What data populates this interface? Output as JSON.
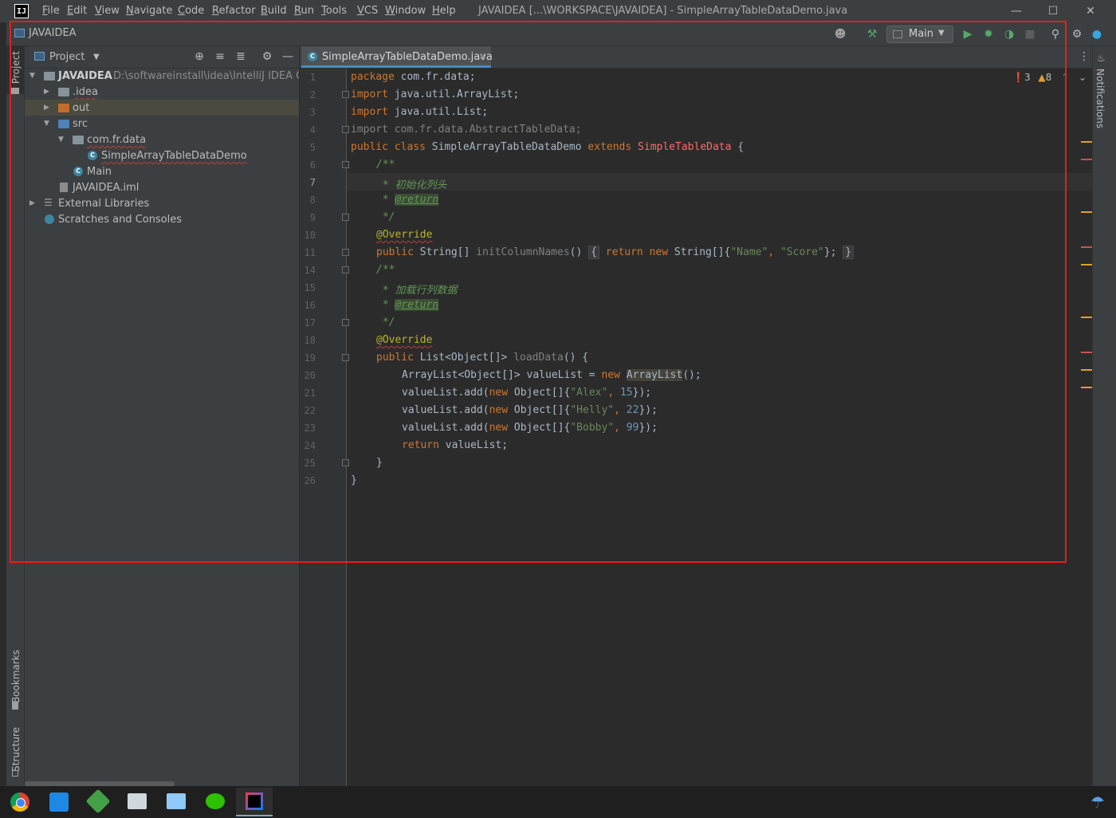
{
  "menu": [
    "File",
    "Edit",
    "View",
    "Navigate",
    "Code",
    "Refactor",
    "Build",
    "Run",
    "Tools",
    "VCS",
    "Window",
    "Help"
  ],
  "window_title": "JAVAIDEA [...\\WORKSPACE\\JAVAIDEA] - SimpleArrayTableDataDemo.java",
  "navbar": {
    "project_name": "JAVAIDEA",
    "run_config": "Main"
  },
  "stripe": {
    "project": "Project",
    "bookmarks": "Bookmarks",
    "structure": "Structure",
    "notifications": "Notifications"
  },
  "project_panel": {
    "title": "Project",
    "tree": [
      {
        "label": "JAVAIDEA",
        "path": "D:\\softwareinstall\\idea\\IntelliJ IDEA Com"
      },
      {
        "label": ".idea"
      },
      {
        "label": "out"
      },
      {
        "label": "src"
      },
      {
        "label": "com.fr.data"
      },
      {
        "label": "SimpleArrayTableDataDemo"
      },
      {
        "label": "Main"
      },
      {
        "label": "JAVAIDEA.iml"
      },
      {
        "label": "External Libraries"
      },
      {
        "label": "Scratches and Consoles"
      }
    ]
  },
  "editor": {
    "tab": "SimpleArrayTableDataDemo.java",
    "inspection": {
      "errors": "3",
      "warnings": "8"
    },
    "line_numbers": [
      "1",
      "2",
      "3",
      "4",
      "5",
      "6",
      "7",
      "8",
      "9",
      "10",
      "11",
      "14",
      "15",
      "16",
      "17",
      "18",
      "19",
      "20",
      "21",
      "22",
      "23",
      "24",
      "25",
      "26"
    ],
    "code": {
      "l1_kw": "package",
      "l1_rest": " com.fr.data;",
      "l2_kw": "import",
      "l2_rest": " java.util.ArrayList;",
      "l3_kw": "import",
      "l3_rest": " java.util.List;",
      "l4": "import com.fr.data.AbstractTableData;",
      "l5_kw": "public class ",
      "l5_name": "SimpleArrayTableDataDemo",
      "l5_ext": " extends ",
      "l5_super": "SimpleTableData",
      "l5_end": " {",
      "l6": "/**",
      "l7": " * 初始化列头",
      "l8_pre": " * ",
      "l8_tag": "@return",
      "l9": " */",
      "l10": "@Override",
      "l11_kw": "public ",
      "l11_type": "String[] ",
      "l11_fn": "initColumnNames",
      "l11_paren": "() ",
      "l11_open": "{",
      "l11_ret": " return new ",
      "l11_arr": "String[]{",
      "l11_s1": "\"Name\"",
      "l11_sep": ", ",
      "l11_s2": "\"Score\"",
      "l11_end": "};",
      "l11_close": "}",
      "l14": "/**",
      "l15": " * 加载行列数据",
      "l16_pre": " * ",
      "l16_tag": "@return",
      "l17": " */",
      "l18": "@Override",
      "l19_kw": "public ",
      "l19_type": "List<Object[]> ",
      "l19_fn": "loadData",
      "l19_end": "() {",
      "l20_a": "ArrayList<Object[]> valueList = ",
      "l20_new": "new ",
      "l20_cls": "ArrayList",
      "l20_end": "();",
      "l21_a": "valueList.add(",
      "l21_new": "new ",
      "l21_b": "Object[]{",
      "l21_s": "\"Alex\"",
      "l21_sep": ", ",
      "l21_n": "15",
      "l21_end": "});",
      "l22_a": "valueList.add(",
      "l22_new": "new ",
      "l22_b": "Object[]{",
      "l22_s": "\"Helly\"",
      "l22_sep": ", ",
      "l22_n": "22",
      "l22_end": "});",
      "l23_a": "valueList.add(",
      "l23_new": "new ",
      "l23_b": "Object[]{",
      "l23_s": "\"Bobby\"",
      "l23_sep": ", ",
      "l23_n": "99",
      "l23_end": "});",
      "l24_kw": "return",
      "l24_rest": " valueList;",
      "l25": "}",
      "l26": "}"
    }
  },
  "colors": {
    "highlight_box": "#e02020",
    "accent": "#4a88c7",
    "error": "#c75450",
    "warning": "#e0a030"
  },
  "taskbar": [
    "chrome-icon",
    "file-manager-icon",
    "download-manager-icon",
    "screen-tool-icon",
    "remote-desktop-icon",
    "wechat-icon",
    "intellij-icon"
  ]
}
